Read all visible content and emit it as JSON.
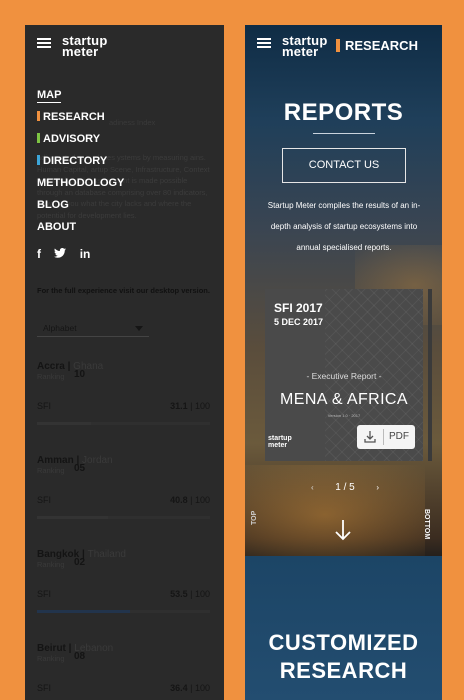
{
  "left": {
    "logo": [
      "startup",
      "meter"
    ],
    "menu": [
      {
        "label": "MAP",
        "selected": true,
        "accent": ""
      },
      {
        "label": "RESEARCH",
        "selected": false,
        "accent": "#f0913f"
      },
      {
        "label": "ADVISORY",
        "selected": false,
        "accent": "#7ec543"
      },
      {
        "label": "DIRECTORY",
        "selected": false,
        "accent": "#3ca6d9"
      },
      {
        "label": "METHODOLOGY",
        "selected": false,
        "accent": ""
      },
      {
        "label": "BLOG",
        "selected": false,
        "accent": ""
      },
      {
        "label": "ABOUT",
        "selected": false,
        "accent": ""
      }
    ],
    "social": [
      "f",
      "t",
      "in"
    ],
    "underlay": {
      "title": "adiness Index",
      "paragraph": "adiness Index analyses ystems by measuring ains. Human Capital, artup Scene, Infrastructure, Context and Market. The ssessment is made possible through an database comprising over 80 indicators, showing you what the city lacks and where the potential for development lies.",
      "desktop_note": "For the full experience visit our desktop version."
    },
    "sort": {
      "selected": "Alphabet"
    },
    "cities": [
      {
        "name": "Accra",
        "country": "Ghana",
        "rank_label": "Ranking",
        "rank": "10",
        "metric": "SFI",
        "score": "31.1",
        "max": "100",
        "fraction": 0.311,
        "highlight": false
      },
      {
        "name": "Amman",
        "country": "Jordan",
        "rank_label": "Ranking",
        "rank": "05",
        "metric": "SFI",
        "score": "40.8",
        "max": "100",
        "fraction": 0.408,
        "highlight": false
      },
      {
        "name": "Bangkok",
        "country": "Thailand",
        "rank_label": "Ranking",
        "rank": "02",
        "metric": "SFI",
        "score": "53.5",
        "max": "100",
        "fraction": 0.535,
        "highlight": true
      },
      {
        "name": "Beirut",
        "country": "Lebanon",
        "rank_label": "Ranking",
        "rank": "08",
        "metric": "SFI",
        "score": "36.4",
        "max": "100",
        "fraction": 0.364,
        "highlight": false
      }
    ]
  },
  "right": {
    "logo": [
      "startup",
      "meter"
    ],
    "section_tag": "RESEARCH",
    "title": "REPORTS",
    "contact_button": "CONTACT US",
    "description": "Startup Meter compiles the results of an in-depth analysis of startup ecosystems into annual specialised reports.",
    "card": {
      "year": "SFI 2017",
      "date": "5 DEC 2017",
      "subtitle": "- Executive Report -",
      "region": "MENA & AFRICA",
      "version": "Version 1.0 · 2017",
      "logo": [
        "startup",
        "meter"
      ],
      "pdf_label": "PDF"
    },
    "pager": {
      "text": "1 / 5",
      "prev": "‹",
      "next": "›"
    },
    "side_top": "TOP",
    "side_bottom": "BOTTOM",
    "next_section_title": [
      "CUSTOMIZED",
      "RESEARCH"
    ]
  },
  "colors": {
    "background": "#f0913f",
    "panel_dark": "#2a2a2a",
    "accent_orange": "#f0913f",
    "accent_green": "#7ec543",
    "accent_blue": "#3ca6d9"
  }
}
